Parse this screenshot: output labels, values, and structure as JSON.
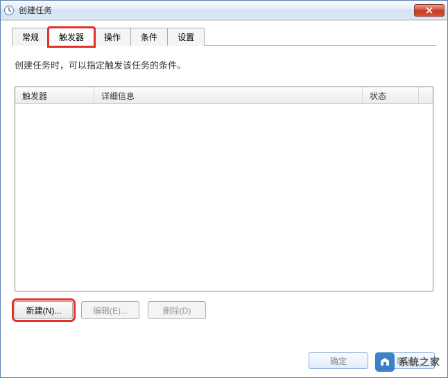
{
  "window": {
    "title": "创建任务"
  },
  "tabs": [
    {
      "id": "general",
      "label": "常规",
      "active": false
    },
    {
      "id": "triggers",
      "label": "触发器",
      "active": true
    },
    {
      "id": "actions",
      "label": "操作",
      "active": false
    },
    {
      "id": "conditions",
      "label": "条件",
      "active": false
    },
    {
      "id": "settings",
      "label": "设置",
      "active": false
    }
  ],
  "description": "创建任务时，可以指定触发该任务的条件。",
  "table": {
    "columns": {
      "trigger": "触发器",
      "detail": "详细信息",
      "status": "状态"
    },
    "rows": []
  },
  "buttons": {
    "new": "新建(N)...",
    "edit": "编辑(E)...",
    "delete": "删除(D)"
  },
  "footer": {
    "ok": "确定",
    "cancel": "取消"
  },
  "watermark": "系统之家"
}
